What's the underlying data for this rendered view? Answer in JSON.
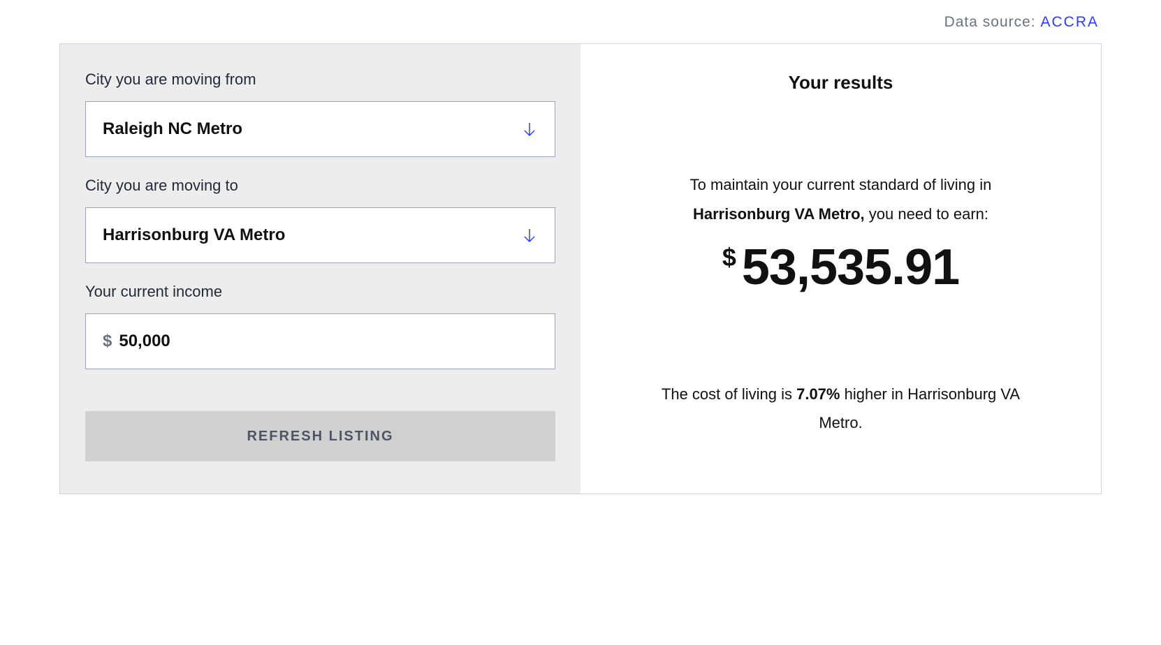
{
  "header": {
    "data_source_label": "Data source: ",
    "data_source_link": "ACCRA"
  },
  "form": {
    "from_label": "City you are moving from",
    "from_value": "Raleigh NC Metro",
    "to_label": "City you are moving to",
    "to_value": "Harrisonburg VA Metro",
    "income_label": "Your current income",
    "income_currency": "$",
    "income_value": "50,000",
    "refresh_button": "REFRESH LISTING"
  },
  "results": {
    "title": "Your results",
    "intro_prefix": "To maintain your current standard of living in ",
    "intro_city": "Harrisonburg VA Metro,",
    "intro_suffix": " you need to earn:",
    "amount_currency": "$",
    "amount_value": "53,535.91",
    "comparison_prefix": "The cost of living is ",
    "comparison_percent": "7.07%",
    "comparison_suffix": " higher in Harrisonburg VA Metro."
  }
}
